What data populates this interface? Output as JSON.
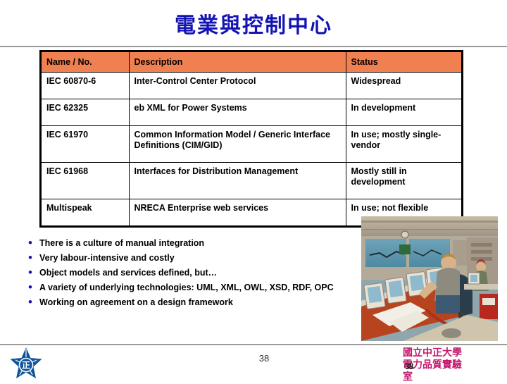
{
  "slide": {
    "title": "電業與控制中心",
    "page_number": "38",
    "title_color": "#1414B4",
    "accent_color": "#F0804F",
    "footer_color": "#C2186B"
  },
  "table": {
    "headers": [
      "Name / No.",
      "Description",
      "Status"
    ],
    "rows": [
      {
        "name": "IEC 60870-6",
        "description": "Inter-Control Center Protocol",
        "status": "Widespread",
        "tall": false
      },
      {
        "name": "IEC 62325",
        "description": "eb XML for Power Systems",
        "status": "In development",
        "tall": false
      },
      {
        "name": "IEC 61970",
        "description": "Common Information Model / Generic Interface Definitions (CIM/GID)",
        "status": "In use; mostly single-vendor",
        "tall": true
      },
      {
        "name": "IEC 61968",
        "description": "Interfaces for Distribution Management",
        "status": "Mostly still in development",
        "tall": true
      },
      {
        "name": "Multispeak",
        "description": "NRECA Enterprise web services",
        "status": "In use; not flexible",
        "tall": false
      }
    ]
  },
  "bullets": [
    {
      "marker": "•",
      "text": "There is a culture of manual integration"
    },
    {
      "marker": "•",
      "text": "Very labour-intensive and costly"
    },
    {
      "marker": "•",
      "text": "Object models and services defined, but…"
    },
    {
      "marker": "•",
      "text": "A variety of underlying technologies: UML, XML, OWL, XSD, RDF, OPC"
    },
    {
      "marker": "•",
      "text": "Working on agreement on a design framework"
    }
  ],
  "photo": {
    "caption": "power-system-control-room-photo"
  },
  "footer": {
    "org_line1": "國立中正大學",
    "org_line2": "電力品質實驗",
    "org_line3": "室",
    "overlay_page_number": "38"
  },
  "logo": {
    "name": "national-chung-cheng-university-logo",
    "character": "正"
  }
}
